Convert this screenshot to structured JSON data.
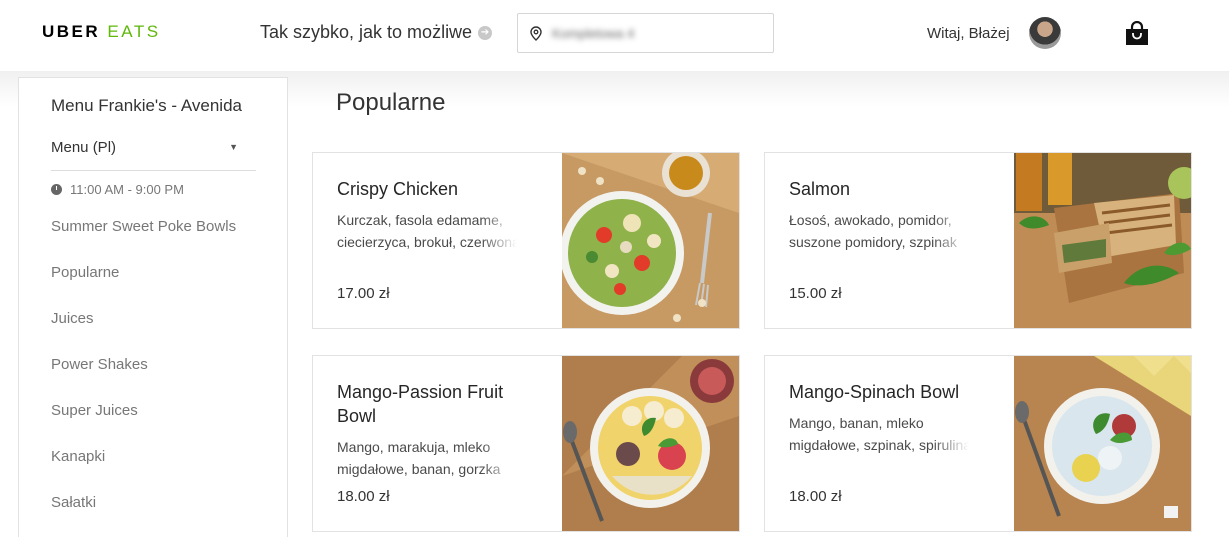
{
  "header": {
    "logo_uber": "UBER",
    "logo_eats": "EATS",
    "delivery_time": "Tak szybko, jak to możliwe",
    "address_value": "Kompletowa 4",
    "greeting": "Witaj, Błażej"
  },
  "sidebar": {
    "restaurant_title": "Menu Frankie's - Avenida",
    "menu_select": "Menu (Pl)",
    "hours": "11:00 AM - 9:00 PM",
    "categories": [
      "Summer Sweet Poke Bowls",
      "Popularne",
      "Juices",
      "Power Shakes",
      "Super Juices",
      "Kanapki",
      "Sałatki"
    ]
  },
  "main": {
    "section_title": "Popularne",
    "items": [
      {
        "name": "Crispy Chicken",
        "desc_line1": "Kurczak, fasola edamame,",
        "desc_line2": "ciecierzyca, brokuł, czerwona",
        "price": "17.00 zł"
      },
      {
        "name": "Salmon",
        "desc_line1": "Łosoś, awokado, pomidor,",
        "desc_line2": "suszone pomidory, szpinak",
        "price": "15.00 zł"
      },
      {
        "name": "Mango-Passion Fruit Bowl",
        "desc_line1": "Mango, marakuja, mleko",
        "desc_line2": "migdałowe, banan, gorzka",
        "price": "18.00 zł"
      },
      {
        "name": "Mango-Spinach Bowl",
        "desc_line1": "Mango, banan, mleko",
        "desc_line2": "migdałowe, szpinak, spirulina",
        "price": "18.00 zł"
      }
    ]
  },
  "colors": {
    "brand_green": "#5fb709",
    "wood": "#b98a55"
  },
  "icons": [
    "arrow-circle-icon",
    "location-pin-icon",
    "shopping-bag-icon",
    "clock-icon",
    "caret-down-icon"
  ]
}
